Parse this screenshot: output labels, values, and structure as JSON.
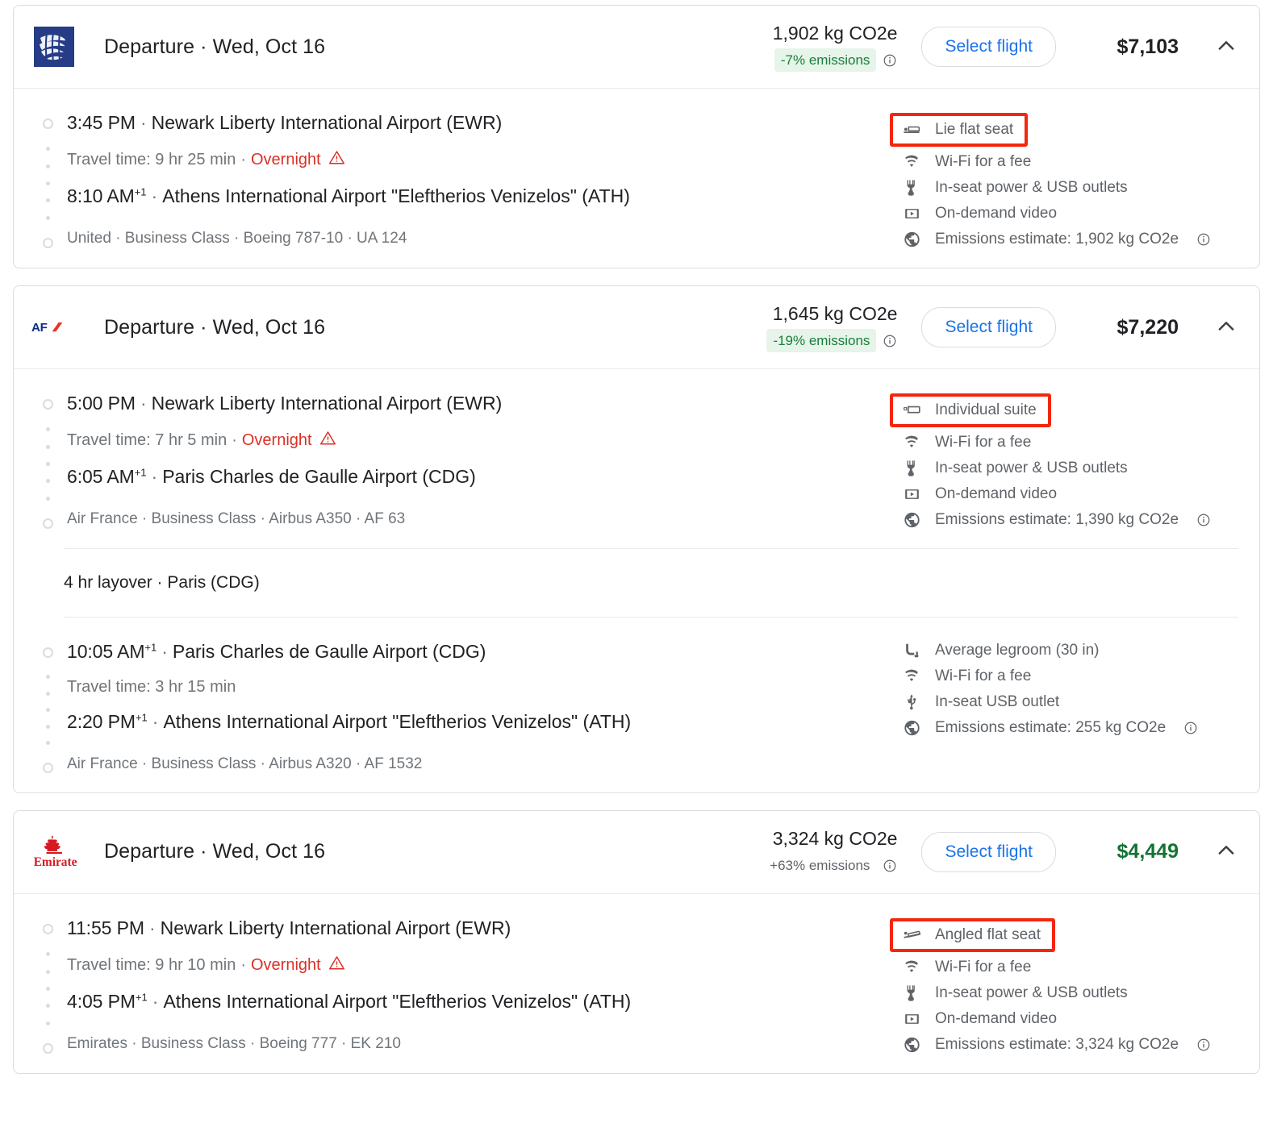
{
  "common": {
    "select_flight_label": "Select flight",
    "departure_word": "Departure",
    "separator_dot": "·",
    "overnight_label": "Overnight",
    "travel_time_prefix": "Travel time: ",
    "info_icon": "info-icon",
    "collapse_icon": "chevron-up-icon",
    "highlight_color": "#f4260d",
    "link_color": "#1a73e8",
    "cheap_price_color": "#137333",
    "low_emissions_color": "#188038",
    "low_emissions_bg": "#e6f4ea",
    "warning_color": "#d93025"
  },
  "flights": [
    {
      "airline_logo": "united-logo",
      "header_title": "Departure  ·  Wed, Oct 16",
      "emissions_total": "1,902 kg CO2e",
      "emissions_pct": "-7% emissions",
      "emissions_level": "low",
      "select_label": "Select flight",
      "price": "$7,103",
      "price_highlight": false,
      "legs": [
        {
          "depart_time": "3:45 PM",
          "depart_plus": "",
          "depart_airport": "Newark Liberty International Airport (EWR)",
          "travel_time": "Travel time: 9 hr 25 min",
          "overnight": "Overnight",
          "arrive_time": "8:10 AM",
          "arrive_plus": "+1",
          "arrive_airport": "Athens International Airport \"Eleftherios Venizelos\" (ATH)",
          "operator": "United · Business Class · Boeing 787-10 · UA 124",
          "amenities": [
            {
              "icon": "lie-flat-seat-icon",
              "label": "Lie flat seat",
              "highlight": true,
              "info": false
            },
            {
              "icon": "wifi-icon",
              "label": "Wi-Fi for a fee",
              "highlight": false,
              "info": false
            },
            {
              "icon": "power-outlet-icon",
              "label": "In-seat power & USB outlets",
              "highlight": false,
              "info": false
            },
            {
              "icon": "video-icon",
              "label": "On-demand video",
              "highlight": false,
              "info": false
            },
            {
              "icon": "emissions-globe-icon",
              "label": "Emissions estimate: 1,902 kg CO2e",
              "highlight": false,
              "info": true
            }
          ]
        }
      ],
      "layovers": []
    },
    {
      "airline_logo": "air-france-logo",
      "header_title": "Departure  ·  Wed, Oct 16",
      "emissions_total": "1,645 kg CO2e",
      "emissions_pct": "-19% emissions",
      "emissions_level": "low",
      "select_label": "Select flight",
      "price": "$7,220",
      "price_highlight": false,
      "legs": [
        {
          "depart_time": "5:00 PM",
          "depart_plus": "",
          "depart_airport": "Newark Liberty International Airport (EWR)",
          "travel_time": "Travel time: 7 hr 5 min",
          "overnight": "Overnight",
          "arrive_time": "6:05 AM",
          "arrive_plus": "+1",
          "arrive_airport": "Paris Charles de Gaulle Airport (CDG)",
          "operator": "Air France · Business Class · Airbus A350 · AF 63",
          "amenities": [
            {
              "icon": "individual-suite-icon",
              "label": "Individual suite",
              "highlight": true,
              "info": false
            },
            {
              "icon": "wifi-icon",
              "label": "Wi-Fi for a fee",
              "highlight": false,
              "info": false
            },
            {
              "icon": "power-outlet-icon",
              "label": "In-seat power & USB outlets",
              "highlight": false,
              "info": false
            },
            {
              "icon": "video-icon",
              "label": "On-demand video",
              "highlight": false,
              "info": false
            },
            {
              "icon": "emissions-globe-icon",
              "label": "Emissions estimate: 1,390 kg CO2e",
              "highlight": false,
              "info": true
            }
          ]
        },
        {
          "depart_time": "10:05 AM",
          "depart_plus": "+1",
          "depart_airport": "Paris Charles de Gaulle Airport (CDG)",
          "travel_time": "Travel time: 3 hr 15 min",
          "overnight": "",
          "arrive_time": "2:20 PM",
          "arrive_plus": "+1",
          "arrive_airport": "Athens International Airport \"Eleftherios Venizelos\" (ATH)",
          "operator": "Air France · Business Class · Airbus A320 · AF 1532",
          "amenities": [
            {
              "icon": "legroom-icon",
              "label": "Average legroom (30 in)",
              "highlight": false,
              "info": false
            },
            {
              "icon": "wifi-icon",
              "label": "Wi-Fi for a fee",
              "highlight": false,
              "info": false
            },
            {
              "icon": "usb-icon",
              "label": "In-seat USB outlet",
              "highlight": false,
              "info": false
            },
            {
              "icon": "emissions-globe-icon",
              "label": "Emissions estimate: 255 kg CO2e",
              "highlight": false,
              "info": true
            }
          ]
        }
      ],
      "layovers": [
        {
          "after_leg": 0,
          "label": "4 hr layover · Paris (CDG)"
        }
      ]
    },
    {
      "airline_logo": "emirates-logo",
      "header_title": "Departure  ·  Wed, Oct 16",
      "emissions_total": "3,324 kg CO2e",
      "emissions_pct": "+63% emissions",
      "emissions_level": "high",
      "select_label": "Select flight",
      "price": "$4,449",
      "price_highlight": true,
      "legs": [
        {
          "depart_time": "11:55 PM",
          "depart_plus": "",
          "depart_airport": "Newark Liberty International Airport (EWR)",
          "travel_time": "Travel time: 9 hr 10 min",
          "overnight": "Overnight",
          "arrive_time": "4:05 PM",
          "arrive_plus": "+1",
          "arrive_airport": "Athens International Airport \"Eleftherios Venizelos\" (ATH)",
          "operator": "Emirates · Business Class · Boeing 777 · EK 210",
          "amenities": [
            {
              "icon": "angled-flat-seat-icon",
              "label": "Angled flat seat",
              "highlight": true,
              "info": false
            },
            {
              "icon": "wifi-icon",
              "label": "Wi-Fi for a fee",
              "highlight": false,
              "info": false
            },
            {
              "icon": "power-outlet-icon",
              "label": "In-seat power & USB outlets",
              "highlight": false,
              "info": false
            },
            {
              "icon": "video-icon",
              "label": "On-demand video",
              "highlight": false,
              "info": false
            },
            {
              "icon": "emissions-globe-icon",
              "label": "Emissions estimate: 3,324 kg CO2e",
              "highlight": false,
              "info": true
            }
          ]
        }
      ],
      "layovers": []
    }
  ]
}
